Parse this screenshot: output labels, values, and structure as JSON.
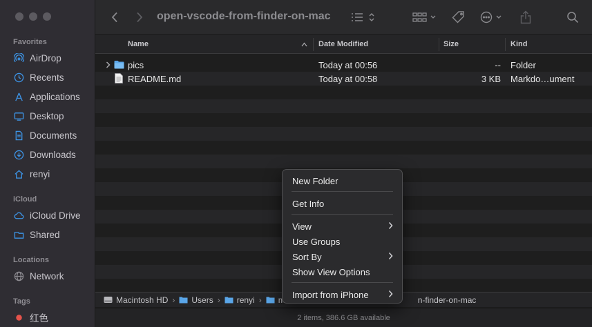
{
  "window": {
    "title": "open-vscode-from-finder-on-mac"
  },
  "sidebar": {
    "favorites_label": "Favorites",
    "favorites": [
      {
        "label": "AirDrop",
        "icon": "airdrop-icon"
      },
      {
        "label": "Recents",
        "icon": "clock-icon"
      },
      {
        "label": "Applications",
        "icon": "applications-icon"
      },
      {
        "label": "Desktop",
        "icon": "desktop-icon"
      },
      {
        "label": "Documents",
        "icon": "document-icon"
      },
      {
        "label": "Downloads",
        "icon": "download-icon"
      },
      {
        "label": "renyi",
        "icon": "home-icon"
      }
    ],
    "icloud_label": "iCloud",
    "icloud": [
      {
        "label": "iCloud Drive",
        "icon": "cloud-icon"
      },
      {
        "label": "Shared",
        "icon": "shared-folder-icon"
      }
    ],
    "locations_label": "Locations",
    "locations": [
      {
        "label": "Network",
        "icon": "globe-icon"
      }
    ],
    "tags_label": "Tags",
    "tags": [
      {
        "label": "红色",
        "color": "#e5534b"
      }
    ]
  },
  "columns": {
    "name": "Name",
    "date": "Date Modified",
    "size": "Size",
    "kind": "Kind"
  },
  "files": [
    {
      "name": "pics",
      "date": "Today at 00:56",
      "size": "--",
      "kind": "Folder",
      "icon": "folder-icon"
    },
    {
      "name": "README.md",
      "date": "Today at 00:58",
      "size": "3 KB",
      "kind": "Markdo…ument",
      "icon": "text-file-icon"
    }
  ],
  "path": [
    "Macintosh HD",
    "Users",
    "renyi",
    "m",
    "n-finder-on-mac"
  ],
  "status": "2 items, 386.6 GB available",
  "context_menu": {
    "new_folder": "New Folder",
    "get_info": "Get Info",
    "view": "View",
    "use_groups": "Use Groups",
    "sort_by": "Sort By",
    "show_view_options": "Show View Options",
    "import_from_iphone": "Import from iPhone"
  },
  "colors": {
    "accent": "#3d95e8",
    "folder": "#5aa6e8",
    "tag_red": "#e5534b"
  }
}
